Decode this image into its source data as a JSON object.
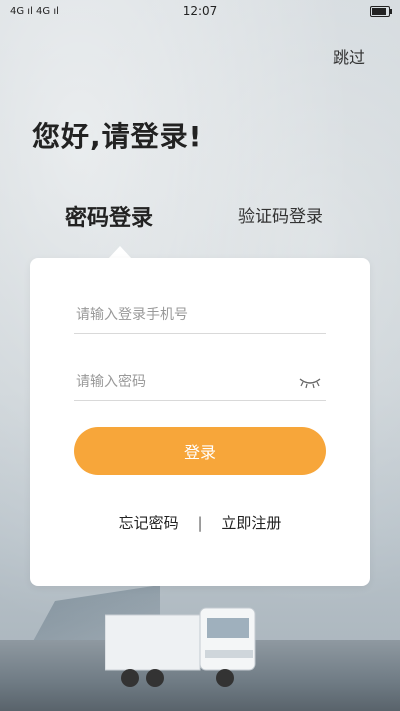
{
  "statusbar": {
    "signal_text": "4G ıl 4G ıl",
    "time": "12:07",
    "battery_level": 0.9
  },
  "header": {
    "skip_label": "跳过",
    "greeting": "您好,请登录!"
  },
  "tabs": [
    {
      "label": "密码登录",
      "active": true
    },
    {
      "label": "验证码登录",
      "active": false
    }
  ],
  "form": {
    "phone_placeholder": "请输入登录手机号",
    "password_placeholder": "请输入密码",
    "password_toggle_icon": "eye-closed-icon",
    "login_label": "登录",
    "forgot_label": "忘记密码",
    "separator": "|",
    "register_label": "立即注册"
  },
  "colors": {
    "accent": "#f7a63a",
    "card": "#ffffff",
    "text": "#222222"
  }
}
